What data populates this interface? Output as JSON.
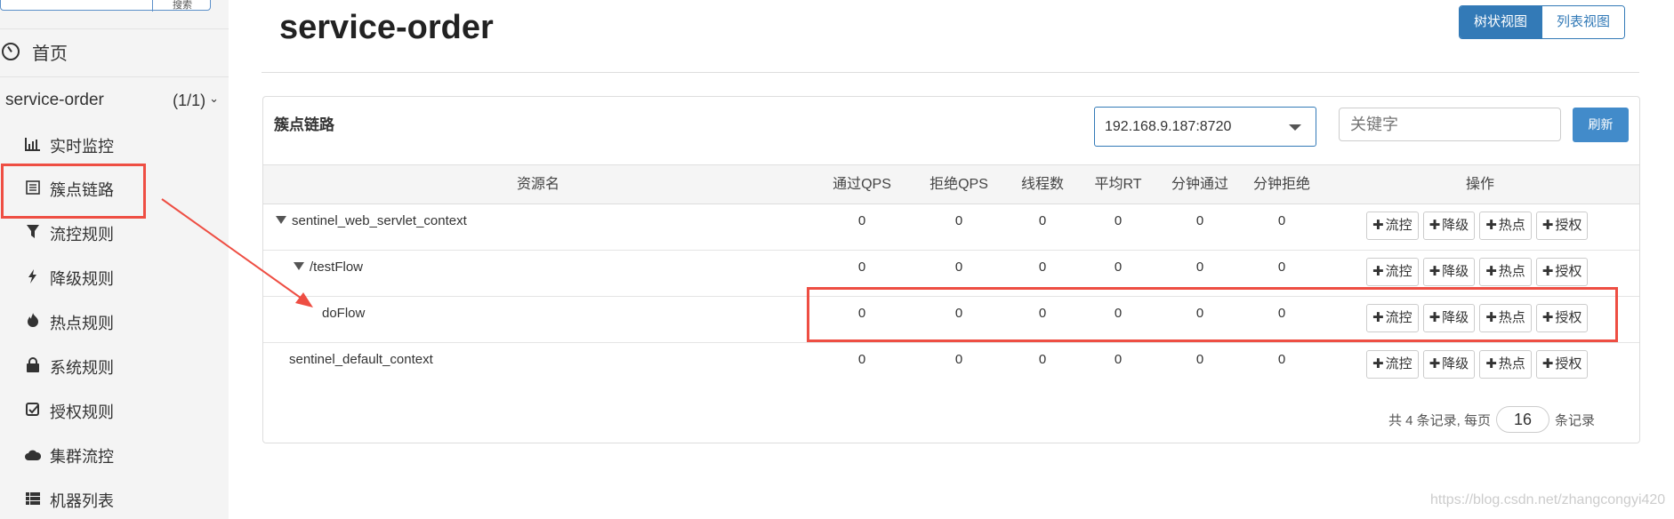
{
  "sidebar": {
    "search_button_label": "搜索",
    "home_label": "首页",
    "app": {
      "name": "service-order",
      "count": "(1/1)",
      "chevron": "⌄"
    },
    "items": [
      {
        "label": "实时监控",
        "icon": "bar-chart-icon",
        "glyph": "📊"
      },
      {
        "label": "簇点链路",
        "icon": "list-icon",
        "glyph": "▤"
      },
      {
        "label": "流控规则",
        "icon": "filter-icon",
        "glyph": "⏷"
      },
      {
        "label": "降级规则",
        "icon": "flash-icon",
        "glyph": "⚡"
      },
      {
        "label": "热点规则",
        "icon": "fire-icon",
        "glyph": "🔥"
      },
      {
        "label": "系统规则",
        "icon": "lock-icon",
        "glyph": "🔒"
      },
      {
        "label": "授权规则",
        "icon": "check-square-icon",
        "glyph": "☑"
      },
      {
        "label": "集群流控",
        "icon": "cloud-icon",
        "glyph": "☁"
      },
      {
        "label": "机器列表",
        "icon": "th-list-icon",
        "glyph": "☷"
      }
    ]
  },
  "header": {
    "title": "service-order",
    "view_toggle": {
      "tree": "树状视图",
      "list": "列表视图"
    }
  },
  "panel": {
    "title": "簇点链路",
    "machine": "192.168.9.187:8720",
    "keyword_placeholder": "关键字",
    "refresh_label": "刷新",
    "columns": [
      "资源名",
      "通过QPS",
      "拒绝QPS",
      "线程数",
      "平均RT",
      "分钟通过",
      "分钟拒绝",
      "操作"
    ],
    "op_labels": [
      "流控",
      "降级",
      "热点",
      "授权"
    ],
    "rows": [
      {
        "name": "sentinel_web_servlet_context",
        "expanded": true,
        "values": [
          "0",
          "0",
          "0",
          "0",
          "0",
          "0"
        ]
      },
      {
        "name": "/testFlow",
        "expanded": true,
        "values": [
          "0",
          "0",
          "0",
          "0",
          "0",
          "0"
        ]
      },
      {
        "name": "doFlow",
        "expanded": false,
        "values": [
          "0",
          "0",
          "0",
          "0",
          "0",
          "0"
        ]
      },
      {
        "name": "sentinel_default_context",
        "expanded": false,
        "values": [
          "0",
          "0",
          "0",
          "0",
          "0",
          "0"
        ]
      }
    ],
    "pager": {
      "prefix": "共 4 条记录, 每页",
      "page_size": "16",
      "suffix": "条记录"
    }
  },
  "annotation_color": "#ee4e43",
  "watermark": "https://blog.csdn.net/zhangcongyi420"
}
